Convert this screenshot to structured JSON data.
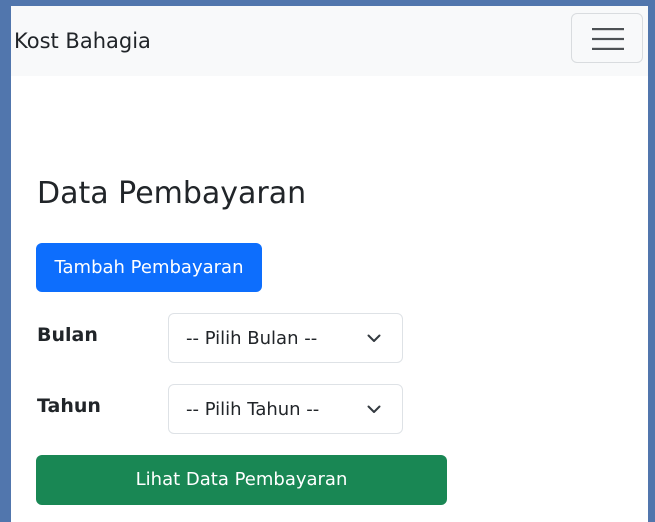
{
  "navbar": {
    "brand": "Kost Bahagia",
    "toggler_icon": "hamburger-menu-icon"
  },
  "page": {
    "title": "Data Pembayaran"
  },
  "actions": {
    "add_payment_label": "Tambah Pembayaran",
    "view_data_label": "Lihat Data Pembayaran"
  },
  "filters": {
    "month": {
      "label": "Bulan",
      "selected": "-- Pilih Bulan --"
    },
    "year": {
      "label": "Tahun",
      "selected": "-- Pilih Tahun --"
    }
  },
  "colors": {
    "primary": "#0d6efd",
    "success": "#198754",
    "navbar_bg": "#f8f9fa",
    "outer_bg": "#5176ad"
  }
}
